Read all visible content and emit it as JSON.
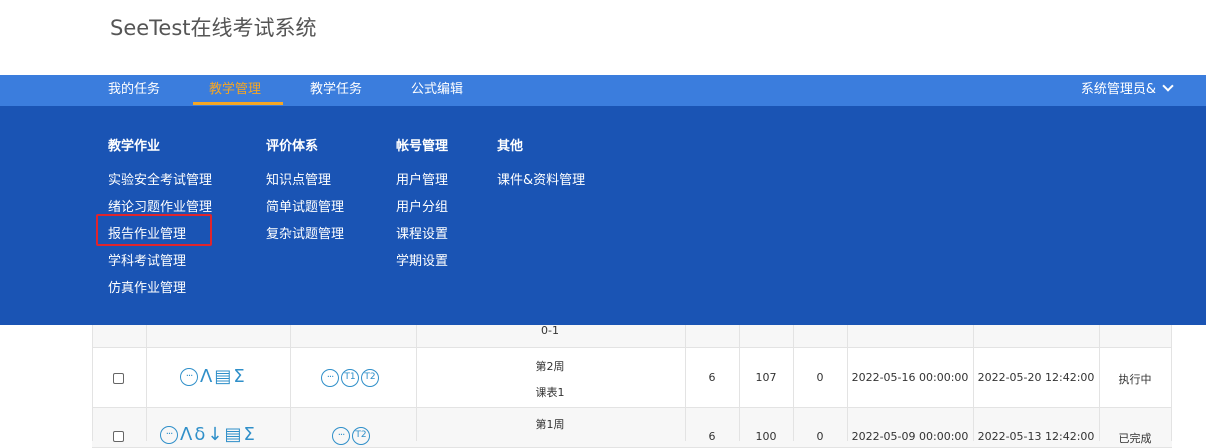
{
  "app_title": "SeeTest在线考试系统",
  "nav": {
    "items": [
      "我的任务",
      "教学管理",
      "教学任务",
      "公式编辑"
    ],
    "active_index": 1,
    "user": "系统管理员&"
  },
  "mega_menu": {
    "columns": [
      {
        "heading": "教学作业",
        "links": [
          "实验安全考试管理",
          "绪论习题作业管理",
          "报告作业管理",
          "学科考试管理",
          "仿真作业管理"
        ]
      },
      {
        "heading": "评价体系",
        "links": [
          "知识点管理",
          "简单试题管理",
          "复杂试题管理"
        ]
      },
      {
        "heading": "帐号管理",
        "links": [
          "用户管理",
          "用户分组",
          "课程设置",
          "学期设置"
        ]
      },
      {
        "heading": "其他",
        "links": [
          "课件&资料管理"
        ]
      }
    ],
    "highlighted": "报告作业管理"
  },
  "table": {
    "rows": [
      {
        "week": "",
        "schedule": "0-1",
        "ops_icons": [
          "more-icon",
          "lambda-icon",
          "clipboard-icon",
          "sigma-icon"
        ],
        "extra_icons": [
          "more-icon",
          "t1-icon",
          "t2-icon"
        ]
      },
      {
        "week": "第2周",
        "schedule": "课表1",
        "ops_icons": [
          "more-icon",
          "lambda-icon",
          "clipboard-icon",
          "sigma-icon"
        ],
        "extra_icons": [
          "more-icon",
          "t1-icon",
          "t2-icon"
        ],
        "c1": "6",
        "c2": "107",
        "c3": "0",
        "start": "2022-05-16 00:00:00",
        "end": "2022-05-20 12:42:00",
        "status": "执行中"
      },
      {
        "week": "第1周",
        "schedule": "",
        "ops_icons": [
          "more-icon",
          "lambda-icon",
          "delta-icon",
          "download-icon",
          "clipboard-icon",
          "sigma-icon"
        ],
        "extra_icons": [
          "more-icon",
          "t2-icon"
        ],
        "c1": "6",
        "c2": "100",
        "c3": "0",
        "start": "2022-05-09 00:00:00",
        "end": "2022-05-13 12:42:00",
        "status": "已完成"
      }
    ]
  },
  "glyphs": {
    "lambda": "Λ",
    "sigma": "Σ",
    "delta": "δ",
    "download": "↓",
    "t1": "T1",
    "t2": "T2",
    "more": "···"
  }
}
